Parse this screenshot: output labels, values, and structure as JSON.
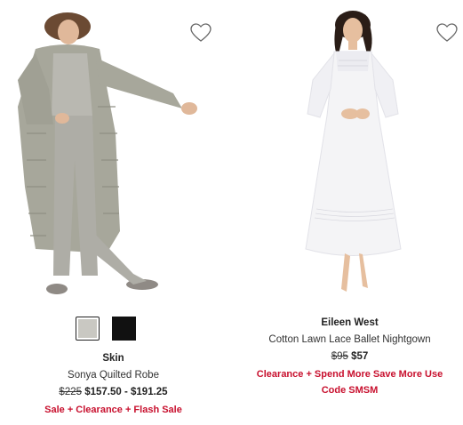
{
  "products": [
    {
      "brand": "Skin",
      "name": "Sonya Quilted Robe",
      "original_price": "$225",
      "sale_price": "$157.50 - $191.25",
      "promo": "Sale + Clearance + Flash Sale",
      "wishlist_icon": "heart-outline-icon",
      "swatches": [
        {
          "color": "#c9c8c2",
          "selected": true
        },
        {
          "color": "#111111",
          "selected": false
        }
      ]
    },
    {
      "brand": "Eileen West",
      "name": "Cotton Lawn Lace Ballet Nightgown",
      "original_price": "$95",
      "sale_price": "$57",
      "promo_line1": "Clearance + Spend More Save More Use",
      "promo_line2": "Code SMSM",
      "wishlist_icon": "heart-outline-icon"
    }
  ],
  "colors": {
    "promo": "#c8102e",
    "text": "#222222"
  }
}
